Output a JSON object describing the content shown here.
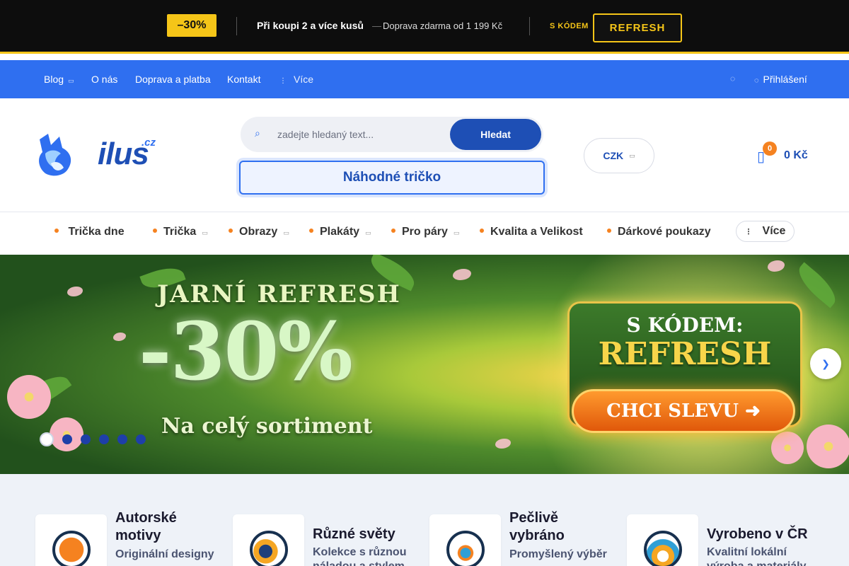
{
  "promo": {
    "badge": "–30%",
    "main": "Při koupi 2 a více kusů",
    "dash": "—",
    "shipping": " Doprava zdarma od 1 199 Kč",
    "code_label": "S KÓDEM",
    "code": "REFRESH",
    "accent_color": "#f5c518"
  },
  "topnav": {
    "items": [
      "Blog",
      "O nás",
      "Doprava a platba",
      "Kontakt"
    ],
    "more": "Více",
    "login": "Přihlášení"
  },
  "header": {
    "logo_text": "ilus",
    "logo_tld": ".cz",
    "search_placeholder": "zadejte hledaný text...",
    "search_button": "Hledat",
    "random_button": " Náhodné tričko",
    "currency": "CZK",
    "cart_count": "0",
    "cart_total": "0 Kč"
  },
  "categories": {
    "items": [
      " Trička dne",
      "Trička",
      "Obrazy",
      "Plakáty",
      "Pro páry",
      "Kvalita a Velikost",
      "Dárkové poukazy"
    ],
    "more": "Více"
  },
  "hero": {
    "line1": "JARNÍ REFRESH",
    "big": "-30%",
    "sub": "Na celý sortiment",
    "card_line1": "S KÓDEM:",
    "card_line2": "REFRESH",
    "cta": "CHCI SLEVU ➜",
    "slides_total": 6,
    "active_slide": 1
  },
  "features": [
    {
      "title": "Autorské motivy",
      "desc": "Originální designy"
    },
    {
      "title": "Různé světy",
      "desc": "Kolekce s různou náladou a stylem"
    },
    {
      "title": "Pečlivě vybráno",
      "desc": "Promyšlený výběr"
    },
    {
      "title": "Vyrobeno v ČR",
      "desc": "Kvalitní lokální výroba a materiály"
    }
  ],
  "colors": {
    "brand_blue": "#2f6ff0",
    "dark_blue": "#1e4fb5",
    "orange": "#f58220"
  }
}
